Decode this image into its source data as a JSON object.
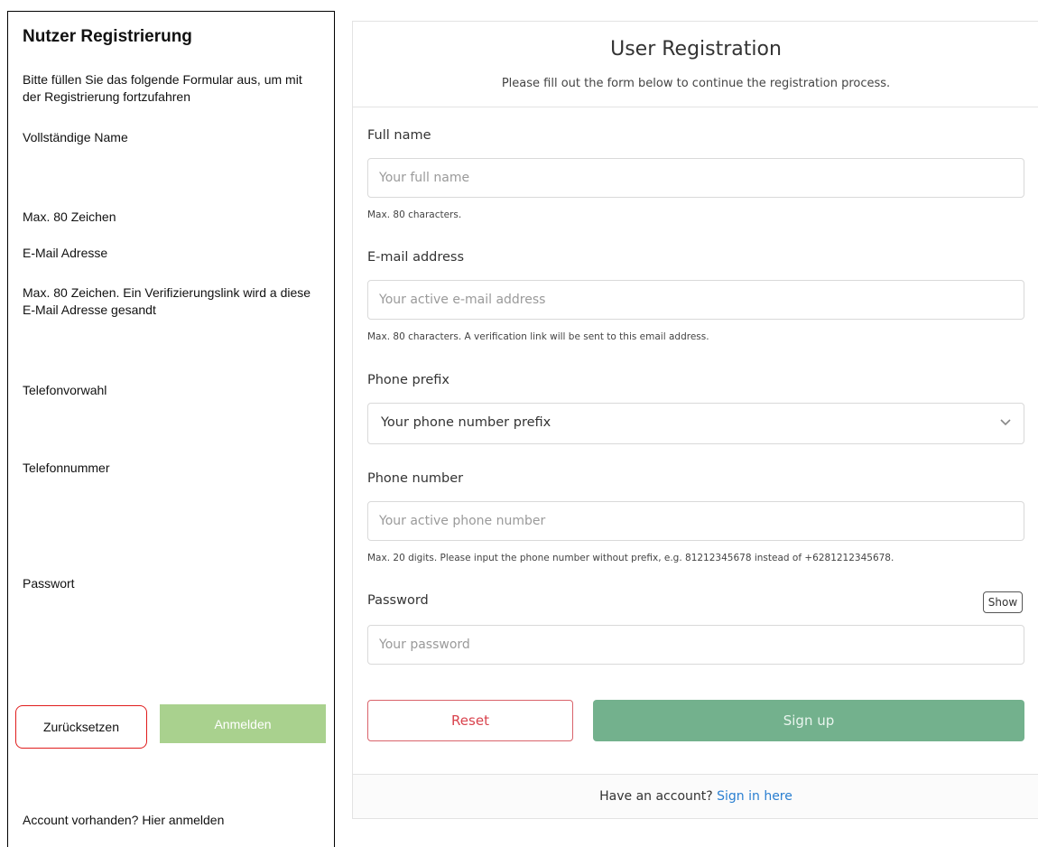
{
  "left": {
    "title": "Nutzer Registrierung",
    "subtitle": "Bitte füllen Sie das folgende Formular aus, um mit der Registrierung fortzufahren",
    "full_name_label": "Vollständige Name",
    "full_name_hint": "Max. 80 Zeichen",
    "email_label": "E-Mail Adresse",
    "email_hint": "Max. 80 Zeichen. Ein Verifizierungslink wird a diese E-Mail Adresse gesandt",
    "prefix_label": "Telefonvorwahl",
    "phone_label": "Telefonnummer",
    "password_label": "Passwort",
    "reset_label": "Zurücksetzen",
    "signup_label": "Anmelden",
    "account_text": "Account vorhanden? Hier anmelden"
  },
  "form": {
    "title": "User Registration",
    "subtitle": "Please fill out the form below to continue the registration process.",
    "full_name": {
      "label": "Full name",
      "placeholder": "Your full name",
      "hint": "Max. 80 characters."
    },
    "email": {
      "label": "E-mail address",
      "placeholder": "Your active e-mail address",
      "hint": "Max. 80 characters. A verification link will be sent to this email address."
    },
    "prefix": {
      "label": "Phone prefix",
      "selected": "Your phone number prefix",
      "icon": "chevron-down-icon"
    },
    "phone": {
      "label": "Phone number",
      "placeholder": "Your active phone number",
      "hint": "Max. 20 digits. Please input the phone number without prefix, e.g. 81212345678 instead of +6281212345678."
    },
    "password": {
      "label": "Password",
      "placeholder": "Your password",
      "show_label": "Show"
    },
    "reset_label": "Reset",
    "signup_label": "Sign up",
    "footer_text": "Have an account?",
    "footer_link": "Sign in here"
  },
  "colors": {
    "reset_border_left": "#e01c1c",
    "signup_left": "#a9d18e",
    "reset_text": "#d9434d",
    "signup_bg": "#73b18d",
    "link": "#2a7fd1"
  }
}
